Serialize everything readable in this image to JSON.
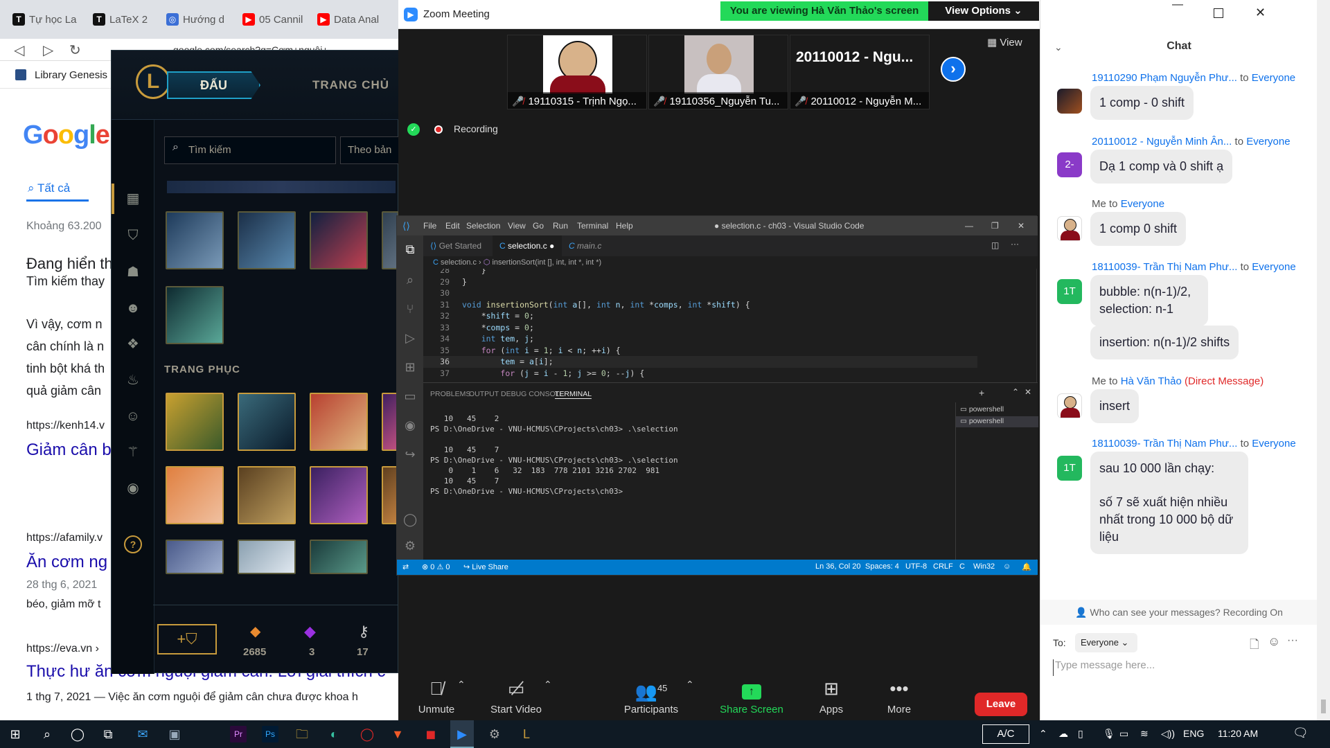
{
  "browser": {
    "tabs": [
      "Tự học La",
      "LaTeX 2",
      "Hướng d",
      "05 Cannil",
      "Data Anal"
    ],
    "url": "google.com/search?q=Cơm+nguội+",
    "bookmark": "Library Genesis",
    "google_logo": "Google",
    "search_tab": "Tất cả",
    "results_count": "Khoảng 63.200",
    "lines": [
      "Đang hiển th",
      "Tìm kiếm thay",
      "Vì vậy, cơm n",
      "cân chính là n",
      "tinh bột khá th",
      "quả giảm cân",
      "https://kenh14.v",
      "Giảm cân b",
      "https://afamily.v",
      "Ăn cơm ng",
      "28 thg 6, 2021",
      "béo, giảm mỡ t",
      "https://eva.vn ›",
      "Thực hư ăn cơm nguội giảm cân: Lời giải thích c",
      "1 thg 7, 2021 — Việc ăn cơm nguội để giảm cân chưa được khoa h"
    ]
  },
  "lol": {
    "play_button": "ĐẤU",
    "home_nav": "TRANG CHỦ",
    "search_placeholder": "Tìm kiếm",
    "sort_label": "Theo bản",
    "skins_header": "TRANG PHỤC",
    "currency": [
      {
        "icon": "blue-essence-icon",
        "value": "2685"
      },
      {
        "icon": "mythic-gem-icon",
        "value": "3"
      },
      {
        "icon": "key-fragment-icon",
        "value": "17"
      }
    ],
    "help": "?"
  },
  "zoom": {
    "title": "Zoom Meeting",
    "viewing_banner": "You are viewing Hà Văn Thảo's screen",
    "view_options": "View Options",
    "view_button": "View",
    "recording": "Recording",
    "participants": [
      {
        "name": "19110315 - Trịnh Ngọ..."
      },
      {
        "name": "19110356_Nguyễn Tu..."
      },
      {
        "name": "20110012 - Nguyễn M...",
        "big_name": "20110012 - Ngu..."
      }
    ],
    "toolbar": {
      "unmute": "Unmute",
      "start_video": "Start Video",
      "participants": "Participants",
      "participants_count": "45",
      "share_screen": "Share Screen",
      "apps": "Apps",
      "more": "More",
      "leave": "Leave"
    }
  },
  "vscode": {
    "menu": [
      "File",
      "Edit",
      "Selection",
      "View",
      "Go",
      "Run",
      "Terminal",
      "Help"
    ],
    "title": "● selection.c - ch03 - Visual Studio Code",
    "tabs": [
      "Get Started",
      "selection.c",
      "main.c"
    ],
    "breadcrumb_file": "selection.c",
    "breadcrumb_symbol": "insertionSort(int [], int, int *, int *)",
    "panel_tabs": [
      "PROBLEMS",
      "OUTPUT",
      "DEBUG CONSOLE",
      "TERMINAL"
    ],
    "shells": [
      "powershell",
      "powershell"
    ],
    "terminal": [
      "   10   45    2",
      "PS D:\\OneDrive - VNU-HCMUS\\CProjects\\ch03> .\\selection",
      "",
      "   10   45    7",
      "PS D:\\OneDrive - VNU-HCMUS\\CProjects\\ch03> .\\selection",
      "    0    1    6   32  183  778 2101 3216 2702  981",
      "   10   45    7",
      "PS D:\\OneDrive - VNU-HCMUS\\CProjects\\ch03> "
    ],
    "status": {
      "errors": "0",
      "warnings": "0",
      "live_share": "Live Share",
      "position": "Ln 36, Col 20",
      "spaces": "Spaces: 4",
      "encoding": "UTF-8",
      "eol": "CRLF",
      "lang": "C",
      "platform": "Win32"
    }
  },
  "chat": {
    "title": "Chat",
    "messages": [
      {
        "sender": "19110290 Phạm Nguyễn Phư...",
        "to": "to",
        "recipient": "Everyone",
        "text": "1 comp - 0 shift"
      },
      {
        "sender": "20110012 - Nguyễn Minh Ân...",
        "to": "to",
        "recipient": "Everyone",
        "avatar": "2-",
        "text": "Dạ 1 comp và 0 shift ạ"
      },
      {
        "sender": "Me",
        "to": "to",
        "recipient": "Everyone",
        "text": "1 comp 0 shift"
      },
      {
        "sender": "18110039- Trần Thị Nam Phư...",
        "to": "to",
        "recipient": "Everyone",
        "avatar": "1T",
        "text": "bubble: n(n-1)/2, selection: n-1",
        "text2": "insertion: n(n-1)/2 shifts"
      },
      {
        "sender": "Me",
        "to": "to",
        "recipient": "Hà Văn Thảo",
        "dm": "(Direct Message)",
        "text": "insert"
      },
      {
        "sender": "18110039- Trần Thị Nam Phư...",
        "to": "to",
        "recipient": "Everyone",
        "avatar": "1T",
        "text": "sau 10 000 lần chạy:",
        "text2": "số 7 sẽ xuất hiện nhiều nhất trong 10 000 bộ dữ liệu"
      }
    ],
    "privacy": "Who can see your messages? Recording On",
    "to_label": "To:",
    "to_value": "Everyone",
    "input_placeholder": "Type message here..."
  },
  "taskbar": {
    "ac": "A/C",
    "lang": "ENG",
    "time": "11:20 AM"
  },
  "colors": {
    "zoom_green": "#23d959",
    "zoom_blue": "#0e71eb",
    "leave_red": "#e02828",
    "vscode_status": "#007acc",
    "lol_gold": "#c89b3c"
  }
}
